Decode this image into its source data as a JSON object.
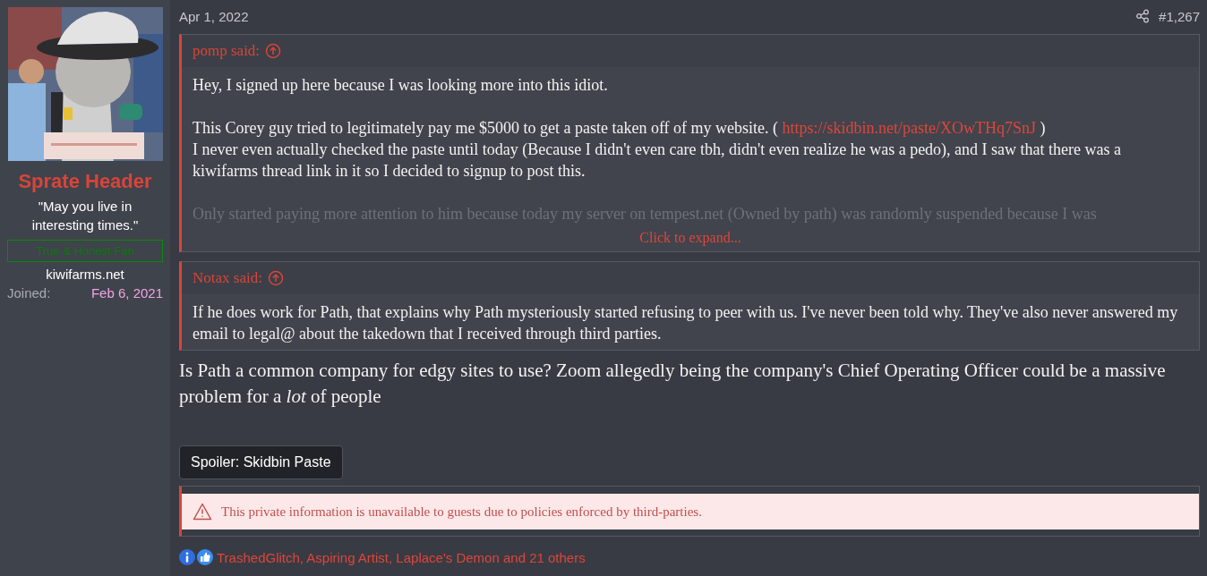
{
  "user": {
    "name": "Sprate Header",
    "title": "\"May you live in interesting times.\"",
    "banner": "True & Honest Fan",
    "site": "kiwifarms.net",
    "joined_label": "Joined:",
    "joined_value": "Feb 6, 2021"
  },
  "post": {
    "date": "Apr 1, 2022",
    "number": "#1,267",
    "quotes": [
      {
        "author": "pomp said:",
        "expand": "Click to expand...",
        "paragraphs": [
          {
            "faded": false,
            "lines": [
              [
                {
                  "kind": "text",
                  "text": "Hey, I signed up here because I was looking more into this idiot."
                }
              ]
            ]
          },
          {
            "faded": false,
            "lines": [
              [
                {
                  "kind": "text",
                  "text": "This Corey guy tried to legitimately pay me $5000 to get a paste taken off of my website. ( "
                },
                {
                  "kind": "link",
                  "text": "https://skidbin.net/paste/XOwTHq7SnJ"
                },
                {
                  "kind": "text",
                  "text": " )"
                }
              ],
              [
                {
                  "kind": "text",
                  "text": "I never even actually checked the paste until today (Because I didn't even care tbh, didn't even realize he was a pedo), and I saw that there was a kiwifarms thread link in it so I decided to signup to post this."
                }
              ]
            ]
          },
          {
            "faded": true,
            "lines": [
              [
                {
                  "kind": "text",
                  "text": "Only started paying more attention to him because today my server on tempest.net (Owned by path) was randomly suspended because I was"
                }
              ]
            ]
          }
        ]
      },
      {
        "author": "Notax said:",
        "paragraphs": [
          {
            "faded": false,
            "lines": [
              [
                {
                  "kind": "text",
                  "text": "If he does work for Path, that explains why Path mysteriously started refusing to peer with us. I've never been told why. They've also never answered my email to legal@ about the takedown that I received through third parties."
                }
              ]
            ]
          }
        ]
      }
    ],
    "body": "Is Path a common company for edgy sites to use? Zoom allegedly being the company's Chief Operating Officer could be a massive problem for a *lot* of people",
    "spoiler": {
      "label": "Spoiler: Skidbin Paste"
    },
    "notice": "This private information is unavailable to guests due to policies enforced by third-parties.",
    "reactions": "TrashedGlitch, Aspiring Artist, Laplace's Demon and 21 others"
  }
}
